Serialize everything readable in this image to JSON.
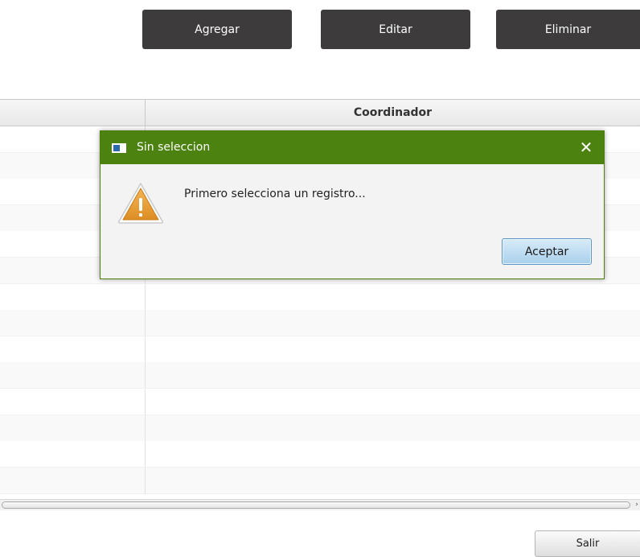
{
  "toolbar": {
    "add_label": "Agregar",
    "edit_label": "Editar",
    "delete_label": "Eliminar"
  },
  "table": {
    "columns": [
      "",
      "Coordinador"
    ],
    "row_count": 14
  },
  "footer": {
    "exit_label": "Salir"
  },
  "dialog": {
    "title": "Sin seleccion",
    "close_glyph": "✕",
    "icon": "warning-icon",
    "message": "Primero selecciona un registro...",
    "ok_label": "Aceptar"
  },
  "colors": {
    "toolbar_button": "#3d3b3c",
    "dialog_titlebar": "#4b8210",
    "warning": "#e8a03a",
    "ok_button": "#a9d0ec"
  }
}
